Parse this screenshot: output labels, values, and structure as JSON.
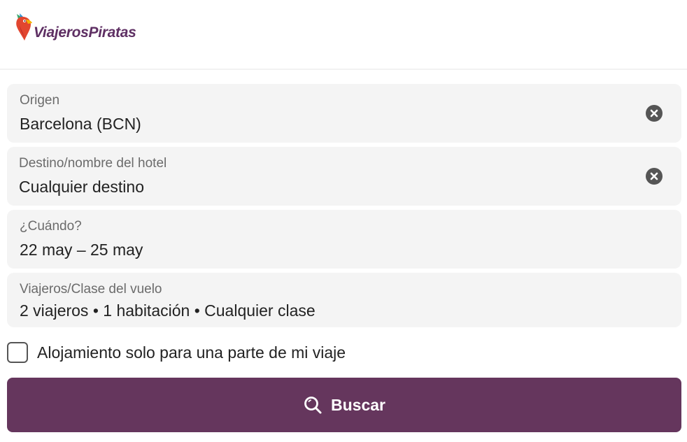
{
  "brand": {
    "name": "ViajerosPiratas",
    "logo_icon": "parrot-location-pin-icon"
  },
  "colors": {
    "brand_purple": "#65365d",
    "logo_text": "#5e2f63",
    "field_background": "#f4f4f4",
    "clear_icon": "#555555"
  },
  "form": {
    "origin": {
      "label": "Origen",
      "value": "Barcelona (BCN)",
      "clear_icon": "close-circle-icon"
    },
    "destination": {
      "label": "Destino/nombre del hotel",
      "value": "Cualquier destino",
      "clear_icon": "close-circle-icon"
    },
    "dates": {
      "label": "¿Cuándo?",
      "value": "22 may – 25 may"
    },
    "travelers": {
      "label": "Viajeros/Clase del vuelo",
      "value": "2 viajeros • 1 habitación • Cualquier clase"
    },
    "partial_stay": {
      "label": "Alojamiento solo para una parte de mi viaje",
      "checked": false
    },
    "search_button": {
      "label": "Buscar",
      "icon": "search-icon"
    }
  }
}
